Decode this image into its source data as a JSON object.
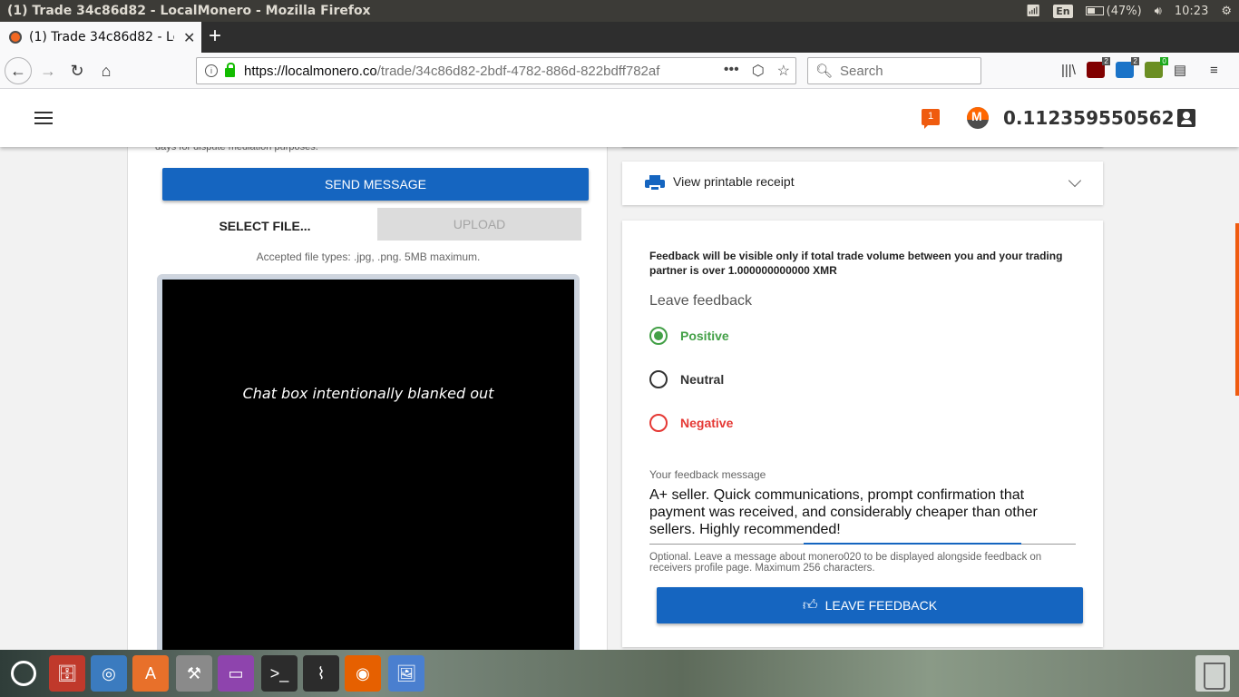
{
  "os_bar": {
    "window_title": "(1) Trade 34c86d82 - LocalMonero - Mozilla Firefox",
    "keyboard": "En",
    "battery": "(47%)",
    "clock": "10:23"
  },
  "browser": {
    "tab_title": "(1) Trade 34c86d82 - LocalMonero",
    "url_host": "https://localmonero.co",
    "url_path": "/trade/34c86d82-2bdf-4782-886d-822bdff782af",
    "search_placeholder": "Search",
    "extensions": [
      {
        "name": "ublock",
        "badge": "2"
      },
      {
        "name": "s-extension",
        "badge": "2"
      },
      {
        "name": "green-extension",
        "badge": "0"
      }
    ]
  },
  "header": {
    "notification_count": "1",
    "balance": "0.112359550562"
  },
  "chat": {
    "dispute_note": "days for dispute mediation purposes.",
    "send_button": "SEND MESSAGE",
    "select_file": "SELECT FILE...",
    "upload_button": "UPLOAD",
    "accepted_types": "Accepted file types: .jpg, .png. 5MB maximum.",
    "blanked_text": "Chat box intentionally blanked out"
  },
  "receipt": {
    "label": "View printable receipt"
  },
  "feedback": {
    "notice": "Feedback will be visible only if total trade volume between you and your trading partner is over 1.000000000000 XMR",
    "title": "Leave feedback",
    "options": {
      "positive": "Positive",
      "neutral": "Neutral",
      "negative": "Negative"
    },
    "selected": "Positive",
    "message_label": "Your feedback message",
    "message_value": "A+ seller. Quick communications, prompt confirmation that payment was received, and considerably cheaper than other sellers. Highly recommended!",
    "message_help": "Optional. Leave a message about monero020 to be displayed alongside feedback on receivers profile page. Maximum 256 characters.",
    "submit_button": "LEAVE FEEDBACK"
  },
  "colors": {
    "primary": "#1565c0",
    "positive": "#43a047",
    "negative": "#e53935",
    "accent": "#ef5b0f"
  }
}
